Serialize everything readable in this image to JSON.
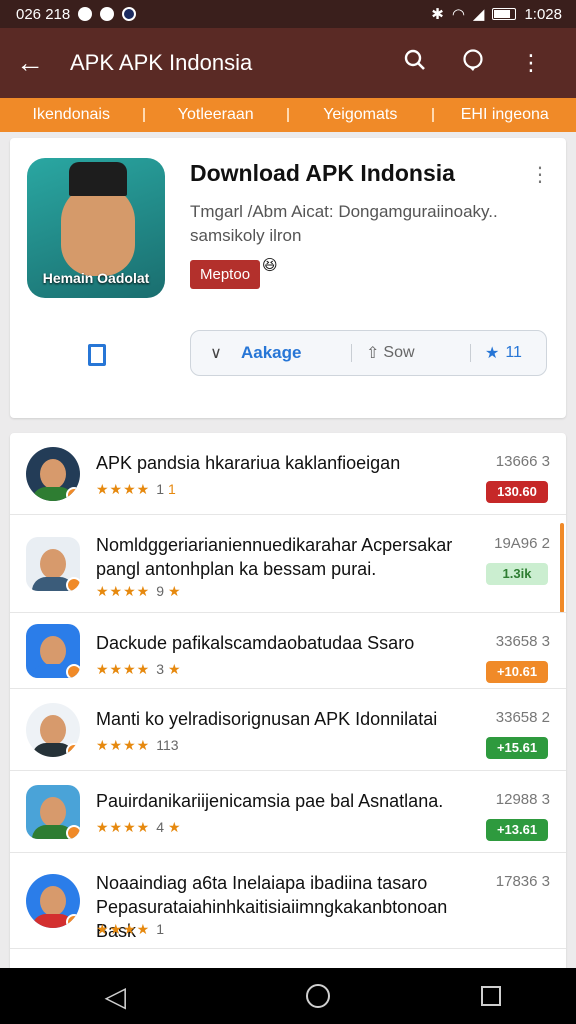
{
  "status_bar": {
    "time_left": "026 218",
    "time_right": "1:028"
  },
  "appbar": {
    "title": "APK APK Indonsia",
    "back_icon": "arrow-back-icon",
    "search_icon": "search-icon",
    "chat_icon": "chat-icon",
    "menu_icon": "more-vert-icon"
  },
  "tabs": [
    "Ikendonais",
    "Yotleeraan",
    "Yeigomats",
    "EHI ingeona"
  ],
  "hero": {
    "icon_label": "Hemain Oadolat",
    "title": "Download APK Indonsia",
    "desc_line1": "Tmgarl /Abm Aicat: Dongamguraiinoaky..",
    "desc_line2": "samsikoly ilron",
    "badge": "Meptoo",
    "action_main": "Aakage",
    "action_share": "Sow",
    "action_star_count": "11"
  },
  "list": [
    {
      "title": "APK pandsia hkarariua kaklanfioeigan",
      "title2": "",
      "stars": "★★★★",
      "rating": "1",
      "suffix": "1",
      "meta": "13666 3",
      "pill": "130.60",
      "pill_color": "#c62828",
      "av_color": "#233c57",
      "body_color": "#2e7d32",
      "square": false
    },
    {
      "title": "Nomldggeriarianiennuedikarahar Acpersakar",
      "title2": "pangl antonhplan ka bessam purai.",
      "stars": "★★★★",
      "rating": "9",
      "suffix": "★",
      "meta": "19A96 2",
      "pill": "1.3ik",
      "pill_color": "#cbeed0",
      "av_color": "#e9eef3",
      "body_color": "#3b5c7a",
      "square": true
    },
    {
      "title": "Dackude pafikalscamdaobatudaa Ssaro",
      "title2": "",
      "stars": "★★★★",
      "rating": "3",
      "suffix": "★",
      "meta": "33658 3",
      "pill": "+10.61",
      "pill_color": "#f08a28",
      "av_color": "#2b7de9",
      "body_color": "#2b7de9",
      "square": true
    },
    {
      "title": "Manti ko yelradisorignusan APK Idonnilatai",
      "title2": "",
      "stars": "★★★★",
      "rating": "113",
      "suffix": "",
      "meta": "33658 2",
      "pill": "+15.61",
      "pill_color": "#2e9a3e",
      "av_color": "#eef2f6",
      "body_color": "#263238",
      "square": false
    },
    {
      "title": "Pauirdanikariijenicamsia pae bal Asnatlana.",
      "title2": "",
      "stars": "★★★★",
      "rating": "4",
      "suffix": "★",
      "meta": "12988 3",
      "pill": "+13.61",
      "pill_color": "#2e9a3e",
      "av_color": "#4aa3d8",
      "body_color": "#2e7d32",
      "square": true
    },
    {
      "title": "Noaaindiag a6ta Inelaiapa ibadiina tasaro",
      "title2": "Pepasurataiahinhkaitisiaiimngkakanbtonoan Bask",
      "stars": "★★★★",
      "rating": "1",
      "suffix": "",
      "meta": "17836 3",
      "pill": "",
      "pill_color": "",
      "av_color": "#2b7de9",
      "body_color": "#d32f2f",
      "square": false
    }
  ],
  "nav": {
    "back_icon": "nav-back-icon",
    "home_icon": "nav-home-icon",
    "recents_icon": "nav-recents-icon"
  }
}
